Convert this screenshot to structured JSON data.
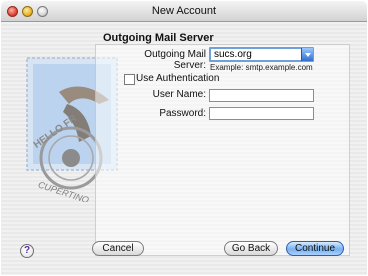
{
  "window": {
    "title": "New Account"
  },
  "section": {
    "heading": "Outgoing Mail Server"
  },
  "form": {
    "server_label": "Outgoing Mail Server:",
    "server_value": "sucs.org",
    "example_text": "Example: smtp.example.com",
    "use_auth_label": "Use Authentication",
    "user_name_label": "User Name:",
    "user_name_value": "",
    "password_label": "Password:",
    "password_value": ""
  },
  "buttons": {
    "help": "?",
    "cancel": "Cancel",
    "go_back": "Go Back",
    "continue": "Continue"
  },
  "stamp": {
    "text_top": "HELLO FR",
    "text_bottom": "CUPERTINO"
  },
  "colors": {
    "accent": "#6fa0dc",
    "default_button": "#78b0ef"
  }
}
